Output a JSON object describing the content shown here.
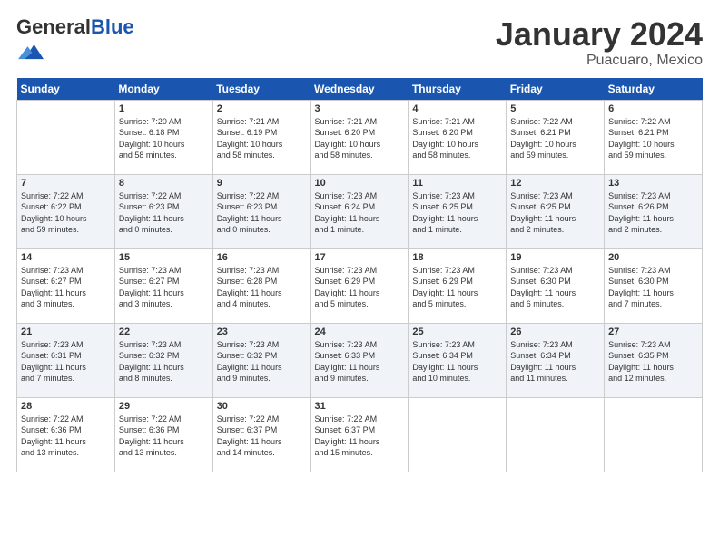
{
  "header": {
    "logo_general": "General",
    "logo_blue": "Blue",
    "month_title": "January 2024",
    "location": "Puacuaro, Mexico"
  },
  "columns": [
    "Sunday",
    "Monday",
    "Tuesday",
    "Wednesday",
    "Thursday",
    "Friday",
    "Saturday"
  ],
  "weeks": [
    [
      {
        "day": "",
        "info": ""
      },
      {
        "day": "1",
        "info": "Sunrise: 7:20 AM\nSunset: 6:18 PM\nDaylight: 10 hours\nand 58 minutes."
      },
      {
        "day": "2",
        "info": "Sunrise: 7:21 AM\nSunset: 6:19 PM\nDaylight: 10 hours\nand 58 minutes."
      },
      {
        "day": "3",
        "info": "Sunrise: 7:21 AM\nSunset: 6:20 PM\nDaylight: 10 hours\nand 58 minutes."
      },
      {
        "day": "4",
        "info": "Sunrise: 7:21 AM\nSunset: 6:20 PM\nDaylight: 10 hours\nand 58 minutes."
      },
      {
        "day": "5",
        "info": "Sunrise: 7:22 AM\nSunset: 6:21 PM\nDaylight: 10 hours\nand 59 minutes."
      },
      {
        "day": "6",
        "info": "Sunrise: 7:22 AM\nSunset: 6:21 PM\nDaylight: 10 hours\nand 59 minutes."
      }
    ],
    [
      {
        "day": "7",
        "info": "Sunrise: 7:22 AM\nSunset: 6:22 PM\nDaylight: 10 hours\nand 59 minutes."
      },
      {
        "day": "8",
        "info": "Sunrise: 7:22 AM\nSunset: 6:23 PM\nDaylight: 11 hours\nand 0 minutes."
      },
      {
        "day": "9",
        "info": "Sunrise: 7:22 AM\nSunset: 6:23 PM\nDaylight: 11 hours\nand 0 minutes."
      },
      {
        "day": "10",
        "info": "Sunrise: 7:23 AM\nSunset: 6:24 PM\nDaylight: 11 hours\nand 1 minute."
      },
      {
        "day": "11",
        "info": "Sunrise: 7:23 AM\nSunset: 6:25 PM\nDaylight: 11 hours\nand 1 minute."
      },
      {
        "day": "12",
        "info": "Sunrise: 7:23 AM\nSunset: 6:25 PM\nDaylight: 11 hours\nand 2 minutes."
      },
      {
        "day": "13",
        "info": "Sunrise: 7:23 AM\nSunset: 6:26 PM\nDaylight: 11 hours\nand 2 minutes."
      }
    ],
    [
      {
        "day": "14",
        "info": "Sunrise: 7:23 AM\nSunset: 6:27 PM\nDaylight: 11 hours\nand 3 minutes."
      },
      {
        "day": "15",
        "info": "Sunrise: 7:23 AM\nSunset: 6:27 PM\nDaylight: 11 hours\nand 3 minutes."
      },
      {
        "day": "16",
        "info": "Sunrise: 7:23 AM\nSunset: 6:28 PM\nDaylight: 11 hours\nand 4 minutes."
      },
      {
        "day": "17",
        "info": "Sunrise: 7:23 AM\nSunset: 6:29 PM\nDaylight: 11 hours\nand 5 minutes."
      },
      {
        "day": "18",
        "info": "Sunrise: 7:23 AM\nSunset: 6:29 PM\nDaylight: 11 hours\nand 5 minutes."
      },
      {
        "day": "19",
        "info": "Sunrise: 7:23 AM\nSunset: 6:30 PM\nDaylight: 11 hours\nand 6 minutes."
      },
      {
        "day": "20",
        "info": "Sunrise: 7:23 AM\nSunset: 6:30 PM\nDaylight: 11 hours\nand 7 minutes."
      }
    ],
    [
      {
        "day": "21",
        "info": "Sunrise: 7:23 AM\nSunset: 6:31 PM\nDaylight: 11 hours\nand 7 minutes."
      },
      {
        "day": "22",
        "info": "Sunrise: 7:23 AM\nSunset: 6:32 PM\nDaylight: 11 hours\nand 8 minutes."
      },
      {
        "day": "23",
        "info": "Sunrise: 7:23 AM\nSunset: 6:32 PM\nDaylight: 11 hours\nand 9 minutes."
      },
      {
        "day": "24",
        "info": "Sunrise: 7:23 AM\nSunset: 6:33 PM\nDaylight: 11 hours\nand 9 minutes."
      },
      {
        "day": "25",
        "info": "Sunrise: 7:23 AM\nSunset: 6:34 PM\nDaylight: 11 hours\nand 10 minutes."
      },
      {
        "day": "26",
        "info": "Sunrise: 7:23 AM\nSunset: 6:34 PM\nDaylight: 11 hours\nand 11 minutes."
      },
      {
        "day": "27",
        "info": "Sunrise: 7:23 AM\nSunset: 6:35 PM\nDaylight: 11 hours\nand 12 minutes."
      }
    ],
    [
      {
        "day": "28",
        "info": "Sunrise: 7:22 AM\nSunset: 6:36 PM\nDaylight: 11 hours\nand 13 minutes."
      },
      {
        "day": "29",
        "info": "Sunrise: 7:22 AM\nSunset: 6:36 PM\nDaylight: 11 hours\nand 13 minutes."
      },
      {
        "day": "30",
        "info": "Sunrise: 7:22 AM\nSunset: 6:37 PM\nDaylight: 11 hours\nand 14 minutes."
      },
      {
        "day": "31",
        "info": "Sunrise: 7:22 AM\nSunset: 6:37 PM\nDaylight: 11 hours\nand 15 minutes."
      },
      {
        "day": "",
        "info": ""
      },
      {
        "day": "",
        "info": ""
      },
      {
        "day": "",
        "info": ""
      }
    ]
  ]
}
